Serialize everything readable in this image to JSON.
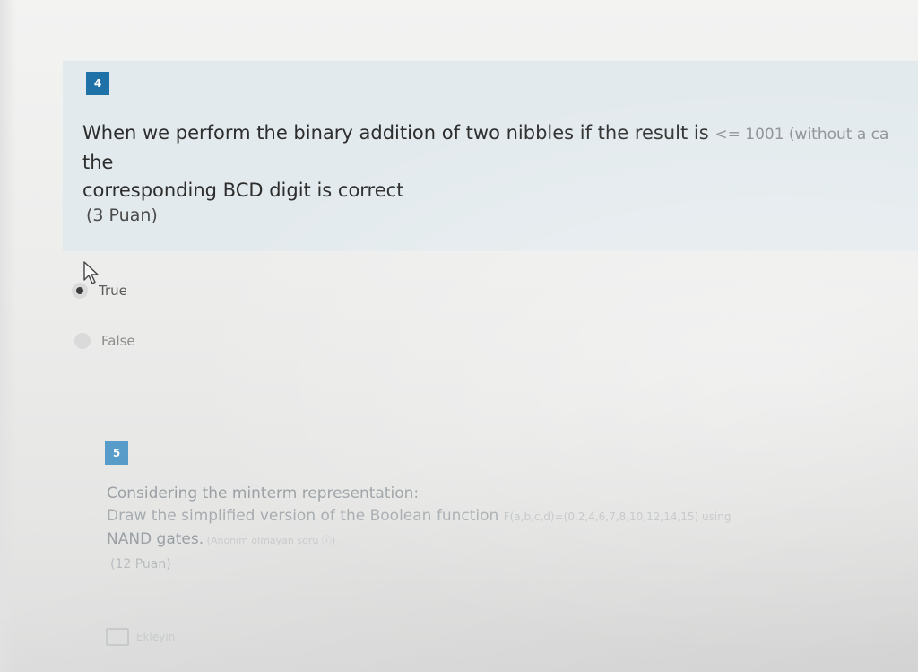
{
  "question4": {
    "number": "4",
    "text_line1_main": "When we perform the binary addition of two nibbles if the result is ",
    "text_line1_faded": "<= 1001 (without a ca",
    "text_line2": "the",
    "text_line3": "corresponding BCD digit is correct",
    "points": "(3 Puan)",
    "options": [
      {
        "label": "True",
        "selected": true
      },
      {
        "label": "False",
        "selected": false
      }
    ]
  },
  "question5": {
    "number": "5",
    "text_line1": "Considering the minterm representation:",
    "text_line2_main": "Draw the simplified version of the Boolean function ",
    "text_line2_faded": "F(a,b,c,d)=(0,2,4,6,7,8,10,12,14,15) using",
    "text_line3_main": "NAND gates.",
    "text_line3_note": " (Anonim olmayan soru ⓘ)",
    "points": "(12 Puan)",
    "upload_label": "Ekleyin"
  },
  "colors": {
    "card_background": "#e3eaed",
    "q4_badge": "#1f72a8",
    "q5_badge": "#3f8fc4"
  },
  "icons": {
    "cursor": "mouse-pointer-icon",
    "upload": "file-upload-icon"
  }
}
